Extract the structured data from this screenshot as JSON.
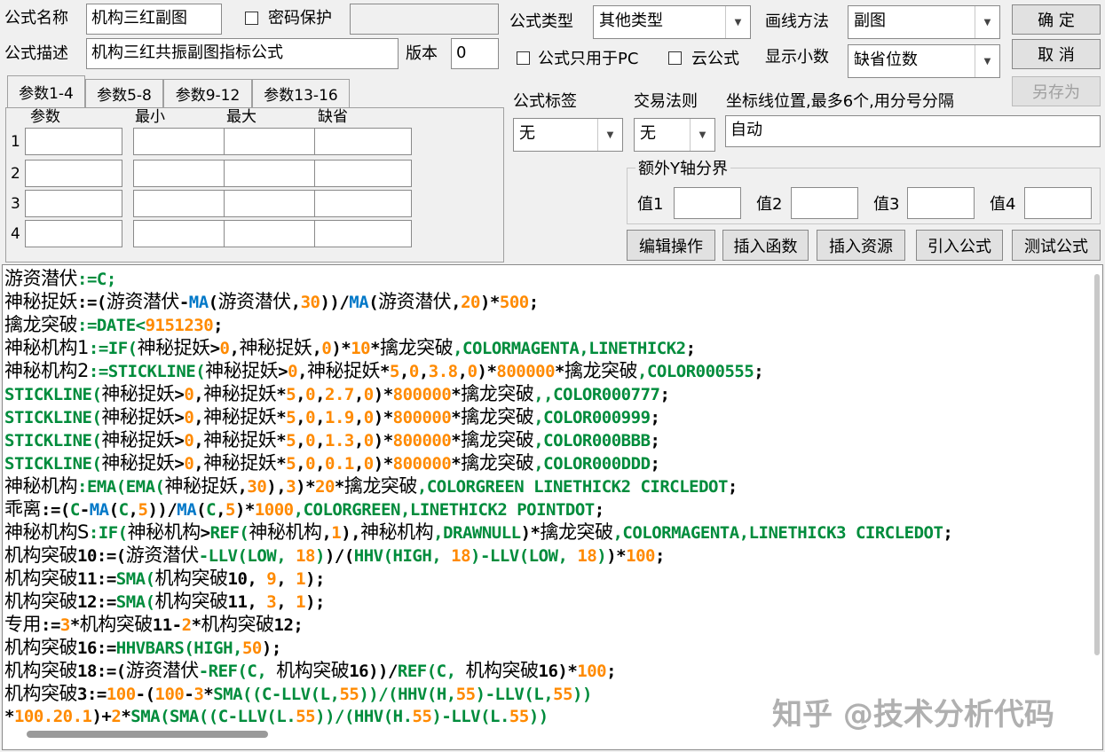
{
  "form": {
    "name_label": "公式名称",
    "name_value": "机构三红副图",
    "password_label": "密码保护",
    "password_value": "",
    "desc_label": "公式描述",
    "desc_value": "机构三红共振副图指标公式",
    "version_label": "版本",
    "version_value": "0",
    "type_label": "公式类型",
    "type_value": "其他类型",
    "draw_label": "画线方法",
    "draw_value": "副图",
    "pc_only_label": "公式只用于PC",
    "cloud_label": "云公式",
    "decimals_label": "显示小数",
    "decimals_value": "缺省位数",
    "tag_label": "公式标签",
    "tag_value": "无",
    "rule_label": "交易法则",
    "rule_value": "无",
    "coord_label": "坐标线位置,最多6个,用分号分隔",
    "coord_value": "自动",
    "yaxis_group": "额外Y轴分界",
    "y1_label": "值1",
    "y2_label": "值2",
    "y3_label": "值3",
    "y4_label": "值4"
  },
  "buttons": {
    "ok": "确 定",
    "cancel": "取 消",
    "save_as": "另存为",
    "edit": "编辑操作",
    "insert_func": "插入函数",
    "insert_res": "插入资源",
    "import": "引入公式",
    "test": "测试公式"
  },
  "tabs": [
    "参数1-4",
    "参数5-8",
    "参数9-12",
    "参数13-16"
  ],
  "params": {
    "headers": [
      "参数",
      "最小",
      "最大",
      "缺省"
    ],
    "rows": [
      "1",
      "2",
      "3",
      "4"
    ]
  },
  "watermark": "知乎 @技术分析代码",
  "code_lines": [
    [
      [
        "n",
        "游资潜伏"
      ],
      [
        "g",
        ":=C;"
      ]
    ],
    [
      [
        "n",
        "神秘捉妖"
      ],
      [
        "k",
        ":=("
      ],
      [
        "n",
        "游资潜伏"
      ],
      [
        "k",
        "-"
      ],
      [
        "b",
        "MA"
      ],
      [
        "k",
        "("
      ],
      [
        "n",
        "游资潜伏"
      ],
      [
        "k",
        ","
      ],
      [
        "o",
        "30"
      ],
      [
        "k",
        "))/"
      ],
      [
        "b",
        "MA"
      ],
      [
        "k",
        "("
      ],
      [
        "n",
        "游资潜伏"
      ],
      [
        "k",
        ","
      ],
      [
        "o",
        "20"
      ],
      [
        "k",
        ")*"
      ],
      [
        "o",
        "500"
      ],
      [
        "k",
        ";"
      ]
    ],
    [
      [
        "n",
        "擒龙突破"
      ],
      [
        "g",
        ":=DATE<"
      ],
      [
        "o",
        "9151230"
      ],
      [
        "k",
        ";"
      ]
    ],
    [
      [
        "n",
        "神秘机构1"
      ],
      [
        "g",
        ":=IF("
      ],
      [
        "n",
        "神秘捉妖"
      ],
      [
        "k",
        ">"
      ],
      [
        "o",
        "0"
      ],
      [
        "k",
        ","
      ],
      [
        "n",
        "神秘捉妖"
      ],
      [
        "k",
        ","
      ],
      [
        "o",
        "0"
      ],
      [
        "k",
        ")*"
      ],
      [
        "o",
        "10"
      ],
      [
        "k",
        "*"
      ],
      [
        "n",
        "擒龙突破"
      ],
      [
        "g",
        ",COLORMAGENTA,LINETHICK2"
      ],
      [
        "k",
        ";"
      ]
    ],
    [
      [
        "n",
        "神秘机构2"
      ],
      [
        "g",
        ":=STICKLINE("
      ],
      [
        "n",
        "神秘捉妖"
      ],
      [
        "k",
        ">"
      ],
      [
        "o",
        "0"
      ],
      [
        "k",
        ","
      ],
      [
        "n",
        "神秘捉妖"
      ],
      [
        "k",
        "*"
      ],
      [
        "o",
        "5"
      ],
      [
        "k",
        ","
      ],
      [
        "o",
        "0"
      ],
      [
        "k",
        ","
      ],
      [
        "o",
        "3.8"
      ],
      [
        "k",
        ","
      ],
      [
        "o",
        "0"
      ],
      [
        "k",
        ")*"
      ],
      [
        "o",
        "800000"
      ],
      [
        "k",
        "*"
      ],
      [
        "n",
        "擒龙突破"
      ],
      [
        "g",
        ",COLOR000555"
      ],
      [
        "k",
        ";"
      ]
    ],
    [
      [
        "g",
        "STICKLINE("
      ],
      [
        "n",
        "神秘捉妖"
      ],
      [
        "k",
        ">"
      ],
      [
        "o",
        "0"
      ],
      [
        "k",
        ","
      ],
      [
        "n",
        "神秘捉妖"
      ],
      [
        "k",
        "*"
      ],
      [
        "o",
        "5"
      ],
      [
        "k",
        ","
      ],
      [
        "o",
        "0"
      ],
      [
        "k",
        ","
      ],
      [
        "o",
        "2.7"
      ],
      [
        "k",
        ","
      ],
      [
        "o",
        "0"
      ],
      [
        "k",
        ")*"
      ],
      [
        "o",
        "800000"
      ],
      [
        "k",
        "*"
      ],
      [
        "n",
        "擒龙突破"
      ],
      [
        "g",
        ",,COLOR000777"
      ],
      [
        "k",
        ";"
      ]
    ],
    [
      [
        "g",
        "STICKLINE("
      ],
      [
        "n",
        "神秘捉妖"
      ],
      [
        "k",
        ">"
      ],
      [
        "o",
        "0"
      ],
      [
        "k",
        ","
      ],
      [
        "n",
        "神秘捉妖"
      ],
      [
        "k",
        "*"
      ],
      [
        "o",
        "5"
      ],
      [
        "k",
        ","
      ],
      [
        "o",
        "0"
      ],
      [
        "k",
        ","
      ],
      [
        "o",
        "1.9"
      ],
      [
        "k",
        ","
      ],
      [
        "o",
        "0"
      ],
      [
        "k",
        ")*"
      ],
      [
        "o",
        "800000"
      ],
      [
        "k",
        "*"
      ],
      [
        "n",
        "擒龙突破"
      ],
      [
        "g",
        ",COLOR000999"
      ],
      [
        "k",
        ";"
      ]
    ],
    [
      [
        "g",
        "STICKLINE("
      ],
      [
        "n",
        "神秘捉妖"
      ],
      [
        "k",
        ">"
      ],
      [
        "o",
        "0"
      ],
      [
        "k",
        ","
      ],
      [
        "n",
        "神秘捉妖"
      ],
      [
        "k",
        "*"
      ],
      [
        "o",
        "5"
      ],
      [
        "k",
        ","
      ],
      [
        "o",
        "0"
      ],
      [
        "k",
        ","
      ],
      [
        "o",
        "1.3"
      ],
      [
        "k",
        ","
      ],
      [
        "o",
        "0"
      ],
      [
        "k",
        ")*"
      ],
      [
        "o",
        "800000"
      ],
      [
        "k",
        "*"
      ],
      [
        "n",
        "擒龙突破"
      ],
      [
        "g",
        ",COLOR000BBB"
      ],
      [
        "k",
        ";"
      ]
    ],
    [
      [
        "g",
        "STICKLINE("
      ],
      [
        "n",
        "神秘捉妖"
      ],
      [
        "k",
        ">"
      ],
      [
        "o",
        "0"
      ],
      [
        "k",
        ","
      ],
      [
        "n",
        "神秘捉妖"
      ],
      [
        "k",
        "*"
      ],
      [
        "o",
        "5"
      ],
      [
        "k",
        ","
      ],
      [
        "o",
        "0"
      ],
      [
        "k",
        ","
      ],
      [
        "o",
        "0.1"
      ],
      [
        "k",
        ","
      ],
      [
        "o",
        "0"
      ],
      [
        "k",
        ")*"
      ],
      [
        "o",
        "800000"
      ],
      [
        "k",
        "*"
      ],
      [
        "n",
        "擒龙突破"
      ],
      [
        "g",
        ",COLOR000DDD"
      ],
      [
        "k",
        ";"
      ]
    ],
    [
      [
        "n",
        "神秘机构"
      ],
      [
        "g",
        ":EMA(EMA("
      ],
      [
        "n",
        "神秘捉妖"
      ],
      [
        "k",
        ","
      ],
      [
        "o",
        "30"
      ],
      [
        "k",
        "),"
      ],
      [
        "o",
        "3"
      ],
      [
        "k",
        ")*"
      ],
      [
        "o",
        "20"
      ],
      [
        "k",
        "*"
      ],
      [
        "n",
        "擒龙突破"
      ],
      [
        "g",
        ",COLORGREEN LINETHICK2 CIRCLEDOT"
      ],
      [
        "k",
        ";"
      ]
    ],
    [
      [
        "n",
        "乖离"
      ],
      [
        "k",
        ":=("
      ],
      [
        "g",
        "C"
      ],
      [
        "k",
        "-"
      ],
      [
        "b",
        "MA"
      ],
      [
        "k",
        "("
      ],
      [
        "g",
        "C"
      ],
      [
        "k",
        ","
      ],
      [
        "o",
        "5"
      ],
      [
        "k",
        "))/"
      ],
      [
        "b",
        "MA"
      ],
      [
        "k",
        "("
      ],
      [
        "g",
        "C"
      ],
      [
        "k",
        ","
      ],
      [
        "o",
        "5"
      ],
      [
        "k",
        ")*"
      ],
      [
        "o",
        "1000"
      ],
      [
        "g",
        ",COLORGREEN,LINETHICK2 POINTDOT"
      ],
      [
        "k",
        ";"
      ]
    ],
    [
      [
        "n",
        "神秘机构S"
      ],
      [
        "g",
        ":IF("
      ],
      [
        "n",
        "神秘机构"
      ],
      [
        "k",
        ">"
      ],
      [
        "g",
        "REF("
      ],
      [
        "n",
        "神秘机构"
      ],
      [
        "k",
        ","
      ],
      [
        "o",
        "1"
      ],
      [
        "k",
        "),"
      ],
      [
        "n",
        "神秘机构"
      ],
      [
        "g",
        ",DRAWNULL"
      ],
      [
        "k",
        ")*"
      ],
      [
        "n",
        "擒龙突破"
      ],
      [
        "g",
        ",COLORMAGENTA,LINETHICK3 CIRCLEDOT"
      ],
      [
        "k",
        ";"
      ]
    ],
    [
      [
        "n",
        "机构突破"
      ],
      [
        "k",
        "10:=("
      ],
      [
        "n",
        "游资潜伏"
      ],
      [
        "g",
        "-LLV(LOW, "
      ],
      [
        "o",
        "18"
      ],
      [
        "g",
        ")"
      ],
      [
        "k",
        ")/("
      ],
      [
        "g",
        "HHV(HIGH, "
      ],
      [
        "o",
        "18"
      ],
      [
        "g",
        ")-LLV(LOW, "
      ],
      [
        "o",
        "18"
      ],
      [
        "g",
        ")"
      ],
      [
        "k",
        ")*"
      ],
      [
        "o",
        "100"
      ],
      [
        "k",
        ";"
      ]
    ],
    [
      [
        "n",
        "机构突破"
      ],
      [
        "k",
        "11:="
      ],
      [
        "g",
        "SMA("
      ],
      [
        "n",
        "机构突破"
      ],
      [
        "k",
        "10, "
      ],
      [
        "o",
        "9"
      ],
      [
        "k",
        ", "
      ],
      [
        "o",
        "1"
      ],
      [
        "k",
        ");"
      ]
    ],
    [
      [
        "n",
        "机构突破"
      ],
      [
        "k",
        "12:="
      ],
      [
        "g",
        "SMA("
      ],
      [
        "n",
        "机构突破"
      ],
      [
        "k",
        "11, "
      ],
      [
        "o",
        "3"
      ],
      [
        "k",
        ", "
      ],
      [
        "o",
        "1"
      ],
      [
        "k",
        ");"
      ]
    ],
    [
      [
        "n",
        "专用"
      ],
      [
        "k",
        ":="
      ],
      [
        "o",
        "3"
      ],
      [
        "k",
        "*"
      ],
      [
        "n",
        "机构突破"
      ],
      [
        "k",
        "11-"
      ],
      [
        "o",
        "2"
      ],
      [
        "k",
        "*"
      ],
      [
        "n",
        "机构突破"
      ],
      [
        "k",
        "12;"
      ]
    ],
    [
      [
        "n",
        "机构突破"
      ],
      [
        "k",
        "16:="
      ],
      [
        "g",
        "HHVBARS(HIGH,"
      ],
      [
        "o",
        "50"
      ],
      [
        "k",
        ");"
      ]
    ],
    [
      [
        "n",
        "机构突破"
      ],
      [
        "k",
        "18:=("
      ],
      [
        "n",
        "游资潜伏"
      ],
      [
        "g",
        "-REF(C, "
      ],
      [
        "n",
        "机构突破"
      ],
      [
        "k",
        "16))/"
      ],
      [
        "g",
        "REF(C, "
      ],
      [
        "n",
        "机构突破"
      ],
      [
        "k",
        "16)*"
      ],
      [
        "o",
        "100"
      ],
      [
        "k",
        ";"
      ]
    ],
    [
      [
        "n",
        "机构突破"
      ],
      [
        "k",
        "3:="
      ],
      [
        "o",
        "100"
      ],
      [
        "k",
        "-("
      ],
      [
        "o",
        "100"
      ],
      [
        "k",
        "-"
      ],
      [
        "o",
        "3"
      ],
      [
        "k",
        "*"
      ],
      [
        "g",
        "SMA((C-LLV(L,"
      ],
      [
        "o",
        "55"
      ],
      [
        "g",
        "))/(HHV(H,"
      ],
      [
        "o",
        "55"
      ],
      [
        "g",
        ")-LLV(L,"
      ],
      [
        "o",
        "55"
      ],
      [
        "g",
        "))"
      ]
    ],
    [
      [
        "k",
        "*"
      ],
      [
        "o",
        "100.20.1"
      ],
      [
        "k",
        ")+"
      ],
      [
        "o",
        "2"
      ],
      [
        "k",
        "*"
      ],
      [
        "g",
        "SMA(SMA((C-LLV(L."
      ],
      [
        "o",
        "55"
      ],
      [
        "g",
        "))/(HHV(H."
      ],
      [
        "o",
        "55"
      ],
      [
        "g",
        ")-LLV(L."
      ],
      [
        "o",
        "55"
      ],
      [
        "g",
        "))"
      ]
    ]
  ]
}
